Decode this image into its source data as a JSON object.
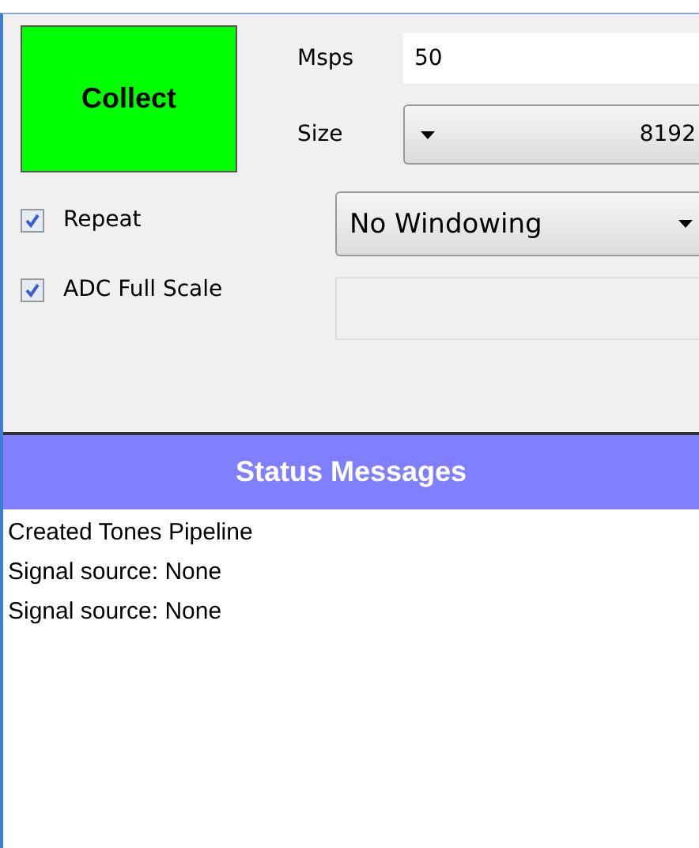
{
  "collect_button": {
    "label": "Collect"
  },
  "msps": {
    "label": "Msps",
    "value": "50"
  },
  "size": {
    "label": "Size",
    "value": "8192"
  },
  "options": [
    {
      "label": "Repeat",
      "checked": true
    },
    {
      "label": "ADC Full Scale",
      "checked": true
    }
  ],
  "windowing": {
    "value": "No Windowing"
  },
  "status": {
    "title": "Status Messages",
    "messages": [
      "Created Tones Pipeline",
      "Signal source: None",
      "Signal source: None"
    ]
  }
}
